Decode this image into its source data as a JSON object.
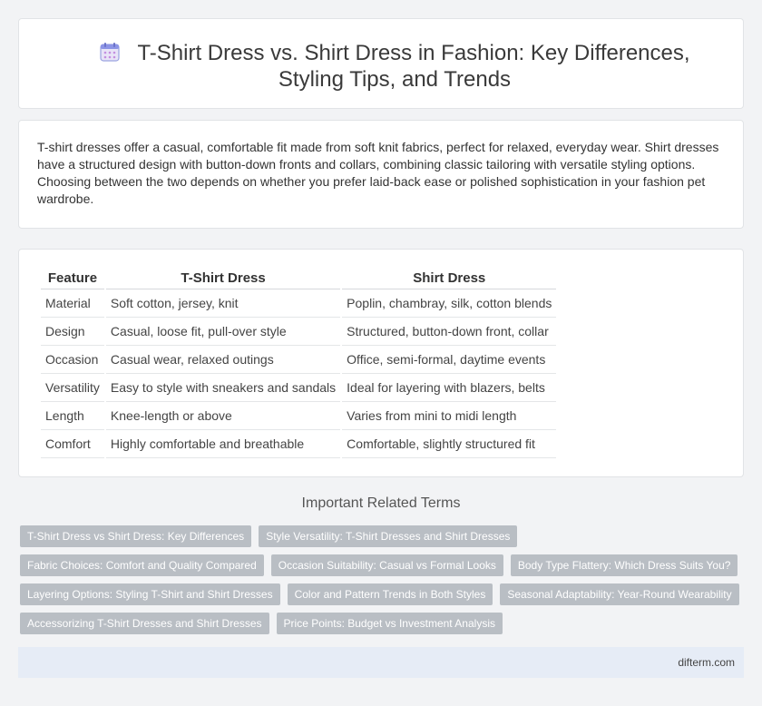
{
  "header": {
    "title": "T-Shirt Dress vs. Shirt Dress in Fashion: Key Differences, Styling Tips, and Trends",
    "icon": "calendar-icon"
  },
  "summary": "T-shirt dresses offer a casual, comfortable fit made from soft knit fabrics, perfect for relaxed, everyday wear. Shirt dresses have a structured design with button-down fronts and collars, combining classic tailoring with versatile styling options. Choosing between the two depends on whether you prefer laid-back ease or polished sophistication in your fashion pet wardrobe.",
  "table": {
    "headers": [
      "Feature",
      "T-Shirt Dress",
      "Shirt Dress"
    ],
    "rows": [
      [
        "Material",
        "Soft cotton, jersey, knit",
        "Poplin, chambray, silk, cotton blends"
      ],
      [
        "Design",
        "Casual, loose fit, pull-over style",
        "Structured, button-down front, collar"
      ],
      [
        "Occasion",
        "Casual wear, relaxed outings",
        "Office, semi-formal, daytime events"
      ],
      [
        "Versatility",
        "Easy to style with sneakers and sandals",
        "Ideal for layering with blazers, belts"
      ],
      [
        "Length",
        "Knee-length or above",
        "Varies from mini to midi length"
      ],
      [
        "Comfort",
        "Highly comfortable and breathable",
        "Comfortable, slightly structured fit"
      ]
    ]
  },
  "related": {
    "heading": "Important Related Terms",
    "rows": [
      [
        "T-Shirt Dress vs Shirt Dress: Key Differences",
        "Style Versatility: T-Shirt Dresses and Shirt Dresses"
      ],
      [
        "Fabric Choices: Comfort and Quality Compared",
        "Occasion Suitability: Casual vs Formal Looks",
        "Body Type Flattery: Which Dress Suits You?"
      ],
      [
        "Layering Options: Styling T-Shirt and Shirt Dresses",
        "Color and Pattern Trends in Both Styles",
        "Seasonal Adaptability: Year-Round Wearability"
      ],
      [
        "Accessorizing T-Shirt Dresses and Shirt Dresses",
        "Price Points: Budget vs Investment Analysis"
      ]
    ]
  },
  "footer": {
    "site": "difterm.com"
  },
  "colors": {
    "tag_bg": "#b9bec4",
    "footer_bg": "#e6ecf6",
    "page_bg": "#f2f3f5"
  }
}
